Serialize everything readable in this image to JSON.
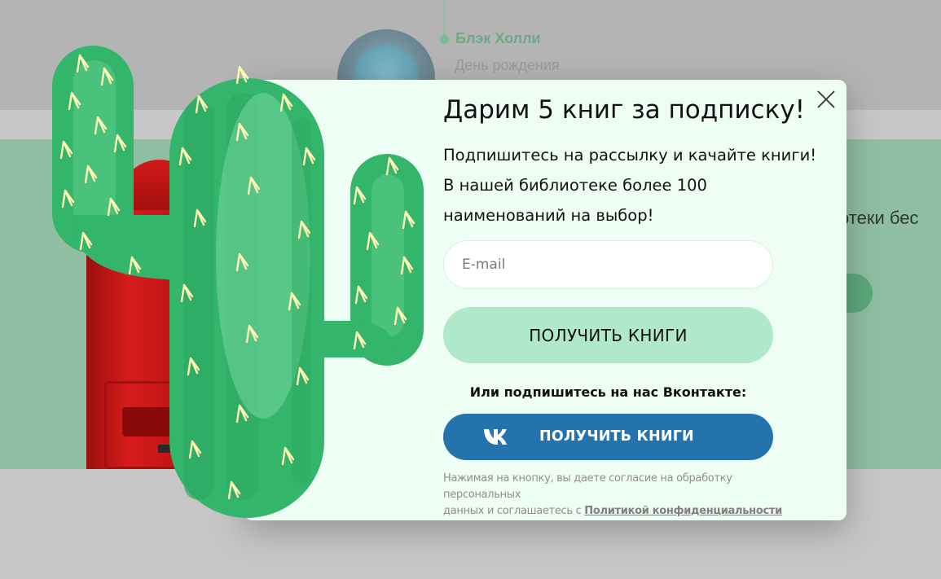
{
  "background": {
    "author_name": "Блэк Холли",
    "event_label": "День рождения",
    "heading_fragment": "отеки бес"
  },
  "modal": {
    "title": "Дарим 5 книг за подписку!",
    "description_lines": [
      "Подпишитесь на рассылку и качайте книги!",
      "В нашей библиотеке более 100",
      "наименований на выбор!"
    ],
    "email_placeholder": "E-mail",
    "submit_label": "ПОЛУЧИТЬ КНИГИ",
    "or_text": "Или подпишитесь на нас Вконтакте:",
    "vk_button_label": "ПОЛУЧИТЬ КНИГИ",
    "consent_line1": "Нажимая на кнопку, вы даете согласие на обработку персональных",
    "consent_line2": "данных и соглашаетесь с ",
    "privacy_link": "Политикой конфиденциальности"
  },
  "icons": {
    "close": "close-icon",
    "vk": "vk-icon"
  },
  "colors": {
    "modal_bg": "#effef4",
    "submit_bg": "#afe9ca",
    "vk_blue": "#2573ad",
    "cactus_green": "#33b56b",
    "overlay_green": "#8fbea2"
  }
}
